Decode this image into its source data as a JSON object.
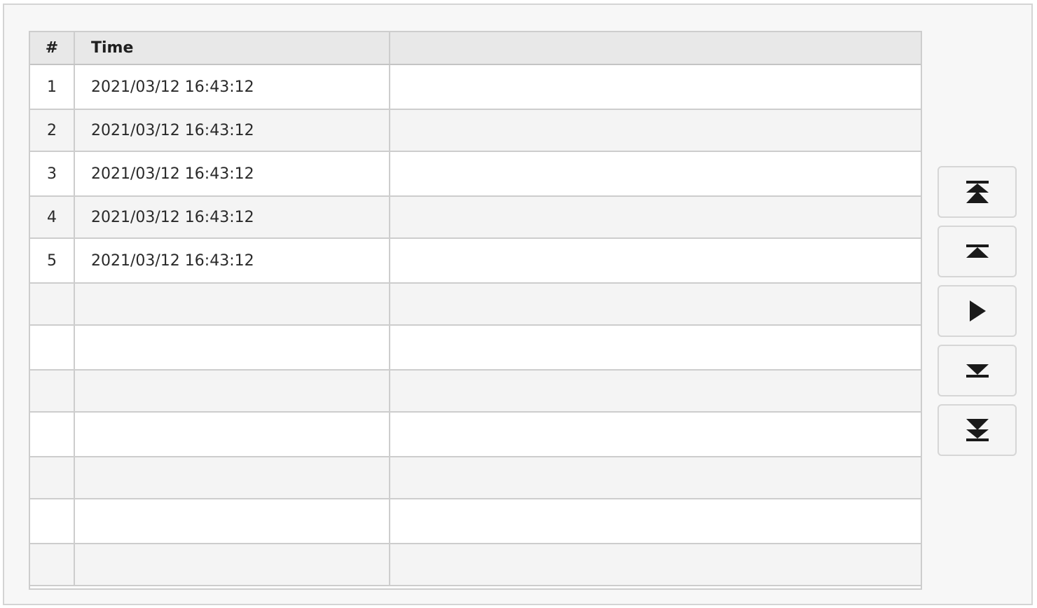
{
  "table": {
    "headers": {
      "num": "#",
      "time": "Time",
      "extra": ""
    },
    "rows": [
      {
        "num": "1",
        "time": "2021/03/12 16:43:12",
        "extra": ""
      },
      {
        "num": "2",
        "time": "2021/03/12 16:43:12",
        "extra": ""
      },
      {
        "num": "3",
        "time": "2021/03/12 16:43:12",
        "extra": ""
      },
      {
        "num": "4",
        "time": "2021/03/12 16:43:12",
        "extra": ""
      },
      {
        "num": "5",
        "time": "2021/03/12 16:43:12",
        "extra": ""
      },
      {
        "num": "",
        "time": "",
        "extra": ""
      },
      {
        "num": "",
        "time": "",
        "extra": ""
      },
      {
        "num": "",
        "time": "",
        "extra": ""
      },
      {
        "num": "",
        "time": "",
        "extra": ""
      },
      {
        "num": "",
        "time": "",
        "extra": ""
      },
      {
        "num": "",
        "time": "",
        "extra": ""
      },
      {
        "num": "",
        "time": "",
        "extra": ""
      }
    ]
  },
  "buttons": [
    {
      "name": "scroll-to-top-button",
      "icon": "double-chevron-up-icon"
    },
    {
      "name": "page-up-button",
      "icon": "chevron-up-icon"
    },
    {
      "name": "play-button",
      "icon": "play-icon"
    },
    {
      "name": "page-down-button",
      "icon": "chevron-down-icon"
    },
    {
      "name": "scroll-to-bottom-button",
      "icon": "double-chevron-down-icon"
    }
  ],
  "colors": {
    "panel_background": "#f7f7f7",
    "header_background": "#e8e8e8",
    "row_alt_background": "#f4f4f4",
    "grid_line": "#cdcdcd",
    "icon": "#1a1a1a"
  }
}
